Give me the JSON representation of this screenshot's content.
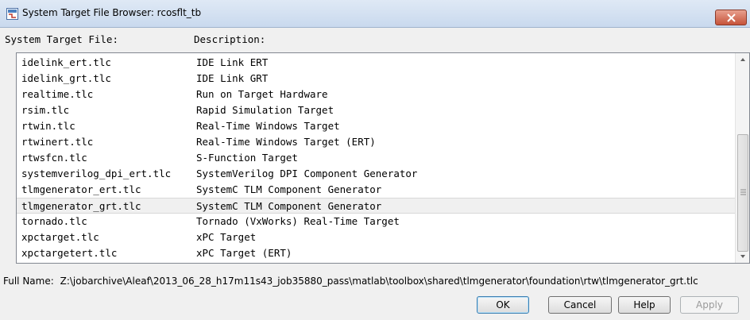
{
  "window": {
    "title": "System Target File Browser: rcosflt_tb",
    "icons": {
      "app": "simulink-icon",
      "close": "close-icon"
    }
  },
  "headers": {
    "file": "System Target File:",
    "description": "Description:"
  },
  "rows": [
    {
      "file": "idelink_ert.tlc",
      "description": "IDE Link ERT"
    },
    {
      "file": "idelink_grt.tlc",
      "description": "IDE Link GRT"
    },
    {
      "file": "realtime.tlc",
      "description": "Run on Target Hardware"
    },
    {
      "file": "rsim.tlc",
      "description": "Rapid Simulation Target"
    },
    {
      "file": "rtwin.tlc",
      "description": "Real-Time Windows Target"
    },
    {
      "file": "rtwinert.tlc",
      "description": "Real-Time Windows Target (ERT)"
    },
    {
      "file": "rtwsfcn.tlc",
      "description": "S-Function Target"
    },
    {
      "file": "systemverilog_dpi_ert.tlc",
      "description": "SystemVerilog DPI Component Generator"
    },
    {
      "file": "tlmgenerator_ert.tlc",
      "description": "SystemC TLM Component Generator"
    },
    {
      "file": "tlmgenerator_grt.tlc",
      "description": "SystemC TLM Component Generator",
      "selected": true
    },
    {
      "file": "tornado.tlc",
      "description": "Tornado (VxWorks) Real-Time Target"
    },
    {
      "file": "xpctarget.tlc",
      "description": "xPC Target"
    },
    {
      "file": "xpctargetert.tlc",
      "description": "xPC Target (ERT)"
    }
  ],
  "full_name": {
    "label": "Full Name:",
    "value": "Z:\\jobarchive\\Aleaf\\2013_06_28_h17m11s43_job35880_pass\\matlab\\toolbox\\shared\\tlmgenerator\\foundation\\rtw\\tlmgenerator_grt.tlc"
  },
  "buttons": {
    "ok": "OK",
    "cancel": "Cancel",
    "help": "Help",
    "apply": "Apply"
  },
  "colors": {
    "selected_row": "#f0f0f0",
    "ok_border": "#3c7fb1",
    "close_button": "#c6533a"
  }
}
